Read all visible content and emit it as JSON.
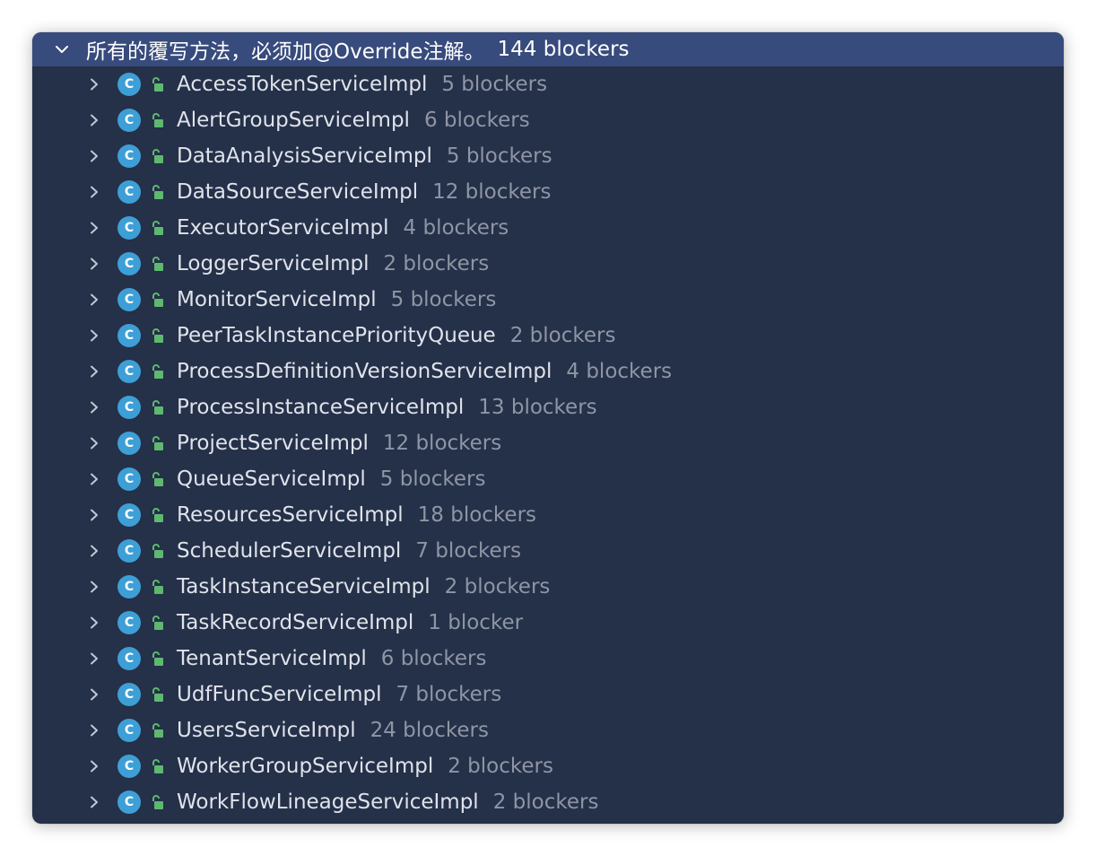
{
  "colors": {
    "panel_background": "#253049",
    "selected_row": "#384b7d",
    "class_icon": "#3d9fd6",
    "lock_icon": "#5fb870",
    "item_text": "#dfe3ea",
    "count_text": "#8e96a5"
  },
  "icons": {
    "expanded": "chevron-down-icon",
    "collapsed": "chevron-right-icon",
    "class": "class-icon",
    "visibility": "unlock-icon"
  },
  "root": {
    "title": "所有的覆写方法，必须加@Override注解。",
    "count": "144 blockers"
  },
  "class_letter": "C",
  "items": [
    {
      "name": "AccessTokenServiceImpl",
      "count": "5 blockers"
    },
    {
      "name": "AlertGroupServiceImpl",
      "count": "6 blockers"
    },
    {
      "name": "DataAnalysisServiceImpl",
      "count": "5 blockers"
    },
    {
      "name": "DataSourceServiceImpl",
      "count": "12 blockers"
    },
    {
      "name": "ExecutorServiceImpl",
      "count": "4 blockers"
    },
    {
      "name": "LoggerServiceImpl",
      "count": "2 blockers"
    },
    {
      "name": "MonitorServiceImpl",
      "count": "5 blockers"
    },
    {
      "name": "PeerTaskInstancePriorityQueue",
      "count": "2 blockers"
    },
    {
      "name": "ProcessDefinitionVersionServiceImpl",
      "count": "4 blockers"
    },
    {
      "name": "ProcessInstanceServiceImpl",
      "count": "13 blockers"
    },
    {
      "name": "ProjectServiceImpl",
      "count": "12 blockers"
    },
    {
      "name": "QueueServiceImpl",
      "count": "5 blockers"
    },
    {
      "name": "ResourcesServiceImpl",
      "count": "18 blockers"
    },
    {
      "name": "SchedulerServiceImpl",
      "count": "7 blockers"
    },
    {
      "name": "TaskInstanceServiceImpl",
      "count": "2 blockers"
    },
    {
      "name": "TaskRecordServiceImpl",
      "count": "1 blocker"
    },
    {
      "name": "TenantServiceImpl",
      "count": "6 blockers"
    },
    {
      "name": "UdfFuncServiceImpl",
      "count": "7 blockers"
    },
    {
      "name": "UsersServiceImpl",
      "count": "24 blockers"
    },
    {
      "name": "WorkerGroupServiceImpl",
      "count": "2 blockers"
    },
    {
      "name": "WorkFlowLineageServiceImpl",
      "count": "2 blockers"
    }
  ]
}
